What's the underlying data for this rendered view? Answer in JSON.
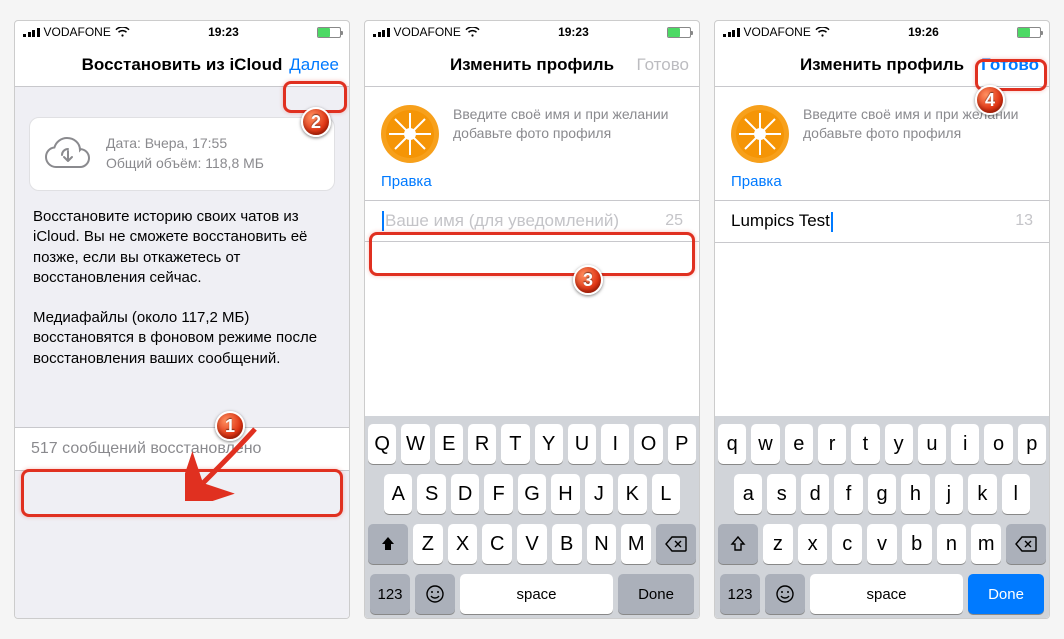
{
  "badges": {
    "one": "1",
    "two": "2",
    "three": "3",
    "four": "4"
  },
  "screen1": {
    "carrier": "VODAFONE",
    "time": "19:23",
    "title": "Восстановить из iCloud",
    "next": "Далее",
    "backup_date": "Дата: Вчера, 17:55",
    "backup_size": "Общий объём: 118,8 МБ",
    "body1": "Восстановите историю своих чатов из iCloud. Вы не сможете восстановить её позже, если вы откажетесь от восстановления сейчас.",
    "body2": "Медиафайлы (около 117,2 МБ) восстановятся в фоновом режиме после восстановления ваших сообщений.",
    "restored": "517 сообщений восстановлено"
  },
  "screen2": {
    "carrier": "VODAFONE",
    "time": "19:23",
    "title": "Изменить профиль",
    "done": "Готово",
    "hint": "Введите своё имя и при желании добавьте фото профиля",
    "edit": "Правка",
    "placeholder": "Ваше имя (для уведомлений)",
    "count": "25"
  },
  "screen3": {
    "carrier": "VODAFONE",
    "time": "19:26",
    "title": "Изменить профиль",
    "done": "Готово",
    "hint": "Введите своё имя и при желании добавьте фото профиля",
    "edit": "Правка",
    "value": "Lumpics Test",
    "count": "13"
  },
  "keyboard": {
    "row1U": [
      "Q",
      "W",
      "E",
      "R",
      "T",
      "Y",
      "U",
      "I",
      "O",
      "P"
    ],
    "row2U": [
      "A",
      "S",
      "D",
      "F",
      "G",
      "H",
      "J",
      "K",
      "L"
    ],
    "row3U": [
      "Z",
      "X",
      "C",
      "V",
      "B",
      "N",
      "M"
    ],
    "row1L": [
      "q",
      "w",
      "e",
      "r",
      "t",
      "y",
      "u",
      "i",
      "o",
      "p"
    ],
    "row2L": [
      "a",
      "s",
      "d",
      "f",
      "g",
      "h",
      "j",
      "k",
      "l"
    ],
    "row3L": [
      "z",
      "x",
      "c",
      "v",
      "b",
      "n",
      "m"
    ],
    "k123": "123",
    "space": "space",
    "done": "Done"
  }
}
